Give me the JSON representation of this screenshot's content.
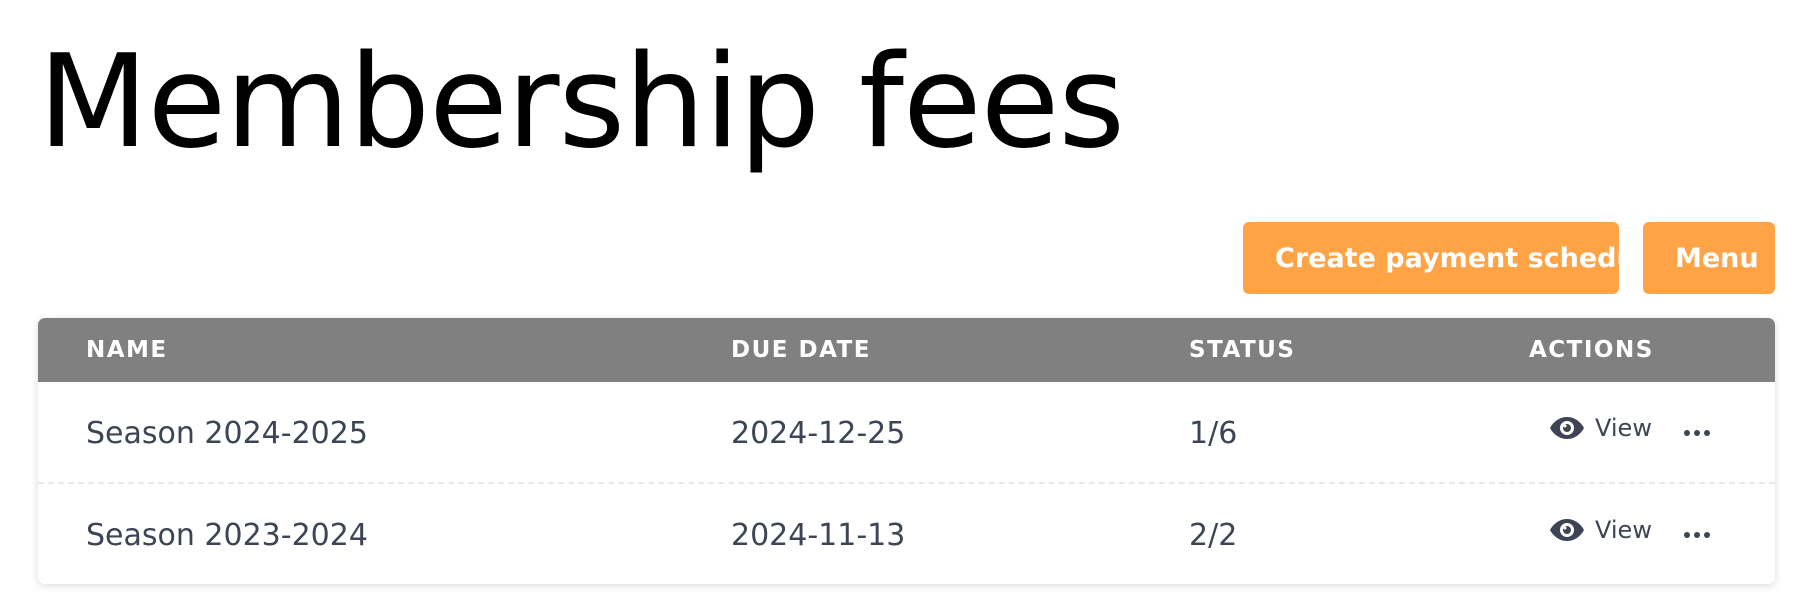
{
  "page": {
    "title": "Membership fees"
  },
  "toolbar": {
    "create_label": "Create payment schedule",
    "menu_label": "Menu",
    "accent": "#ffa347"
  },
  "table": {
    "header_bg": "#808080",
    "columns": [
      "NAME",
      "DUE DATE",
      "STATUS",
      "ACTIONS"
    ],
    "rows": [
      {
        "name": "Season 2024-2025",
        "due_date": "2024-12-25",
        "status": "1/6",
        "view_label": "View"
      },
      {
        "name": "Season 2023-2024",
        "due_date": "2024-11-13",
        "status": "2/2",
        "view_label": "View"
      }
    ]
  },
  "icons": {
    "view": "eye-icon",
    "more": "more-horizontal-icon"
  }
}
